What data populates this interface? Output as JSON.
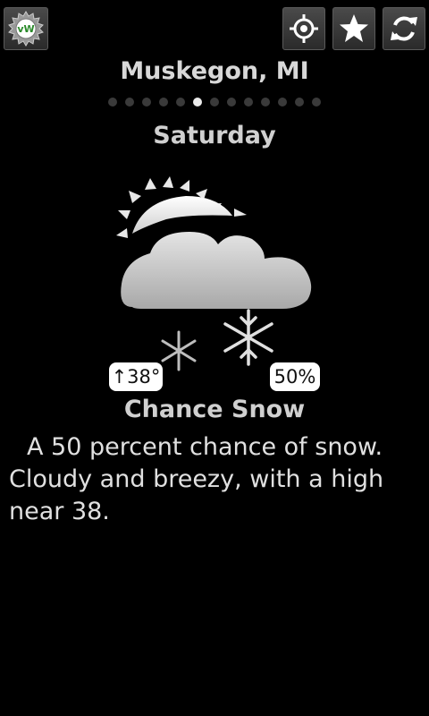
{
  "header": {
    "app_logo_text": "vW",
    "buttons": [
      {
        "icon": "locate-icon"
      },
      {
        "icon": "star-icon"
      },
      {
        "icon": "refresh-icon"
      }
    ]
  },
  "location": {
    "name": "Muskegon, MI"
  },
  "pager": {
    "count": 13,
    "active_index": 5
  },
  "forecast": {
    "day": "Saturday",
    "icon": "sun-cloud-snow-icon",
    "high_temp": "↑38°",
    "precip_chance": "50%",
    "condition": "Chance Snow",
    "description": "A 50 percent chance of snow. Cloudy and breezy, with a high near 38."
  }
}
